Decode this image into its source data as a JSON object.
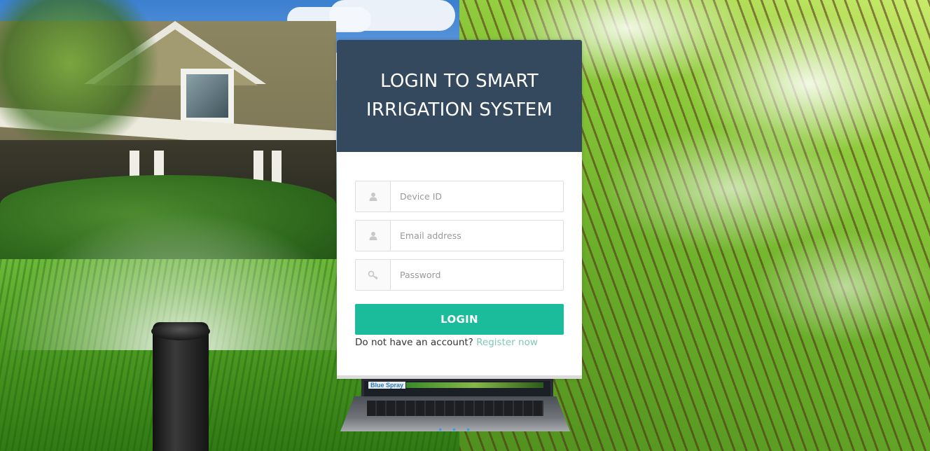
{
  "login": {
    "title": "LOGIN TO SMART IRRIGATION SYSTEM",
    "fields": {
      "device_id": {
        "placeholder": "Device ID",
        "value": "",
        "icon": "user-icon"
      },
      "email": {
        "placeholder": "Email address",
        "value": "",
        "icon": "user-icon"
      },
      "password": {
        "placeholder": "Password",
        "value": "",
        "icon": "key-icon"
      }
    },
    "button_label": "LOGIN",
    "register_prompt": "Do not have an account?",
    "register_link": "Register now"
  },
  "background": {
    "laptop_brand": "Blue Spray"
  },
  "colors": {
    "header_bg": "#34495e",
    "button_bg": "#1abc9c",
    "link": "#7fc8b6"
  }
}
